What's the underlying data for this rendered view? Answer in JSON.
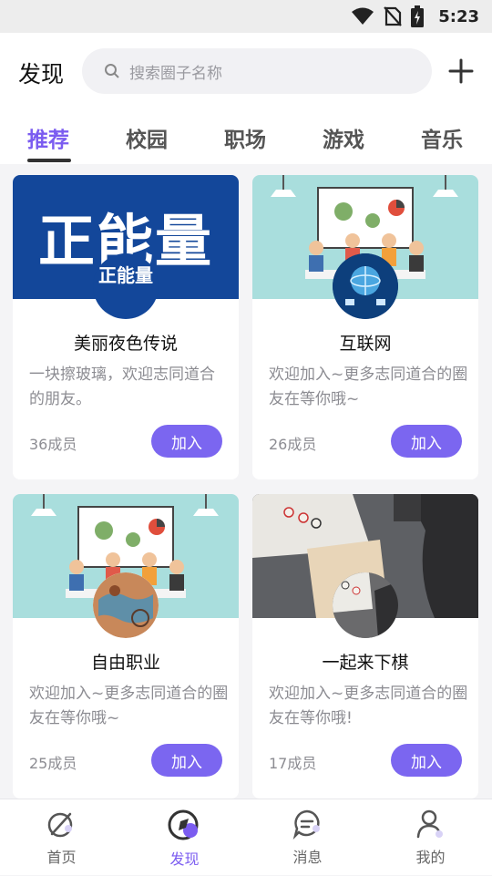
{
  "status_bar": {
    "time": "5:23",
    "icons": [
      "wifi-icon",
      "no-sim-icon",
      "battery-charging-icon"
    ]
  },
  "header": {
    "title": "发现",
    "search_placeholder": "搜索圈子名称",
    "add_icon": "plus-icon"
  },
  "tabs": [
    {
      "label": "推荐",
      "active": true
    },
    {
      "label": "校园",
      "active": false
    },
    {
      "label": "职场",
      "active": false
    },
    {
      "label": "游戏",
      "active": false
    },
    {
      "label": "音乐",
      "active": false
    }
  ],
  "cards": [
    {
      "name": "美丽夜色传说",
      "description": "一块擦玻璃，欢迎志同道合的朋友。",
      "members": "36成员",
      "join_label": "加入",
      "cover": "正能量",
      "avatar_text": "正能量"
    },
    {
      "name": "互联网",
      "description": "欢迎加入~更多志同道合的圈友在等你哦~",
      "members": "26成员",
      "join_label": "加入"
    },
    {
      "name": "自由职业",
      "description": "欢迎加入~更多志同道合的圈友在等你哦~",
      "members": "25成员",
      "join_label": "加入"
    },
    {
      "name": "一起来下棋",
      "description": "欢迎加入~更多志同道合的圈友在等你哦!",
      "members": "17成员",
      "join_label": "加入"
    }
  ],
  "bottom_nav": [
    {
      "label": "首页",
      "icon": "compass-home-icon",
      "active": false
    },
    {
      "label": "发现",
      "icon": "compass-icon",
      "active": true
    },
    {
      "label": "消息",
      "icon": "message-icon",
      "active": false
    },
    {
      "label": "我的",
      "icon": "user-icon",
      "active": false
    }
  ],
  "colors": {
    "accent": "#7b5cf0",
    "join_button": "#7b66f0",
    "cover_blue": "#13479a",
    "cover_teal": "#a9dedd"
  }
}
